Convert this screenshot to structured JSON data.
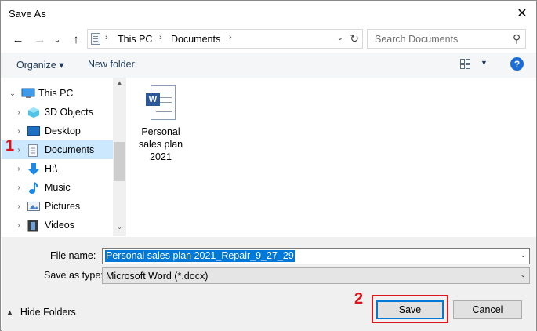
{
  "window": {
    "title": "Save As",
    "close_glyph": "✕"
  },
  "nav": {
    "back_glyph": "←",
    "forward_glyph": "→",
    "recent_glyph": "⌄",
    "up_glyph": "↑",
    "breadcrumbs": [
      "This PC",
      "Documents"
    ],
    "separator_glyph": "›",
    "dropdown_glyph": "⌄",
    "refresh_glyph": "↻",
    "search_placeholder": "Search Documents",
    "search_glyph": "⚲"
  },
  "toolbar": {
    "organize_label": "Organize ▾",
    "new_folder_label": "New folder",
    "view_dropdown_glyph": "▼",
    "help_glyph": "?"
  },
  "tree": {
    "expanded_glyph": "⌄",
    "collapsed_glyph": "›",
    "items": [
      {
        "label": "This PC",
        "icon": "computer-icon"
      },
      {
        "label": "3D Objects",
        "icon": "cube-icon"
      },
      {
        "label": "Desktop",
        "icon": "desktop-icon"
      },
      {
        "label": "Documents",
        "icon": "document-folder-icon",
        "selected": true
      },
      {
        "label": "H:\\",
        "icon": "drive-arrow-icon"
      },
      {
        "label": "Music",
        "icon": "music-note-icon"
      },
      {
        "label": "Pictures",
        "icon": "picture-icon"
      },
      {
        "label": "Videos",
        "icon": "film-icon"
      }
    ],
    "scroll_up_glyph": "▲",
    "scroll_down_glyph": "⌄"
  },
  "files": [
    {
      "name": "Personal sales plan 2021",
      "icon": "word-document-icon",
      "badge": "W"
    }
  ],
  "form": {
    "file_name_label": "File name:",
    "file_name_value": "Personal sales plan 2021_Repair_9_27_29",
    "save_type_label": "Save as type:",
    "save_type_value": "Microsoft Word (*.docx)",
    "dropdown_glyph": "⌄"
  },
  "footer": {
    "hide_folders_label": "Hide Folders",
    "hide_glyph": "▲",
    "save_label": "Save",
    "cancel_label": "Cancel"
  },
  "annotations": {
    "step1": "1",
    "step2": "2",
    "color": "#d8161c"
  },
  "colors": {
    "selection": "#cce8ff",
    "accent": "#0078d7",
    "word_blue": "#2b5797",
    "help_blue": "#1a6dd8"
  }
}
